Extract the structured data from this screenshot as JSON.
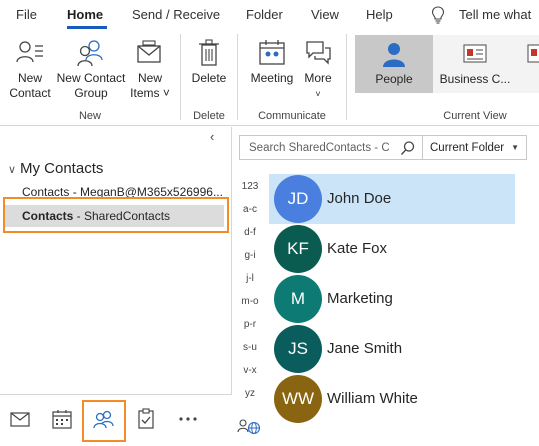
{
  "tabs": [
    {
      "label": "File",
      "active": false
    },
    {
      "label": "Home",
      "active": true
    },
    {
      "label": "Send / Receive",
      "active": false
    },
    {
      "label": "Folder",
      "active": false
    },
    {
      "label": "View",
      "active": false
    },
    {
      "label": "Help",
      "active": false
    }
  ],
  "tell_me": "Tell me what",
  "ribbon": {
    "new_contact": "New\nContact",
    "new_contact_group": "New Contact\nGroup",
    "new_items": "New\nItems",
    "group_new": "New",
    "delete": "Delete",
    "group_delete": "Delete",
    "meeting": "Meeting",
    "more": "More",
    "group_communicate": "Communicate",
    "people": "People",
    "business_card": "Business C...",
    "group_current_view": "Current View"
  },
  "folder_pane": {
    "section": "My Contacts",
    "items": [
      {
        "bold": "",
        "label": "Contacts - MeganB@M365x526996..."
      },
      {
        "bold": "Contacts",
        "label": " - SharedContacts"
      }
    ],
    "selected_index": 1
  },
  "bottom_nav": [
    "mail-icon",
    "calendar-icon",
    "people-icon",
    "tasks-icon",
    "more-icon"
  ],
  "search": {
    "placeholder": "Search SharedContacts - C",
    "scope": "Current Folder"
  },
  "alphabet": [
    "123",
    "a-c",
    "d-f",
    "g-i",
    "j-l",
    "m-o",
    "p-r",
    "s-u",
    "v-x",
    "yz"
  ],
  "contacts": [
    {
      "initials": "JD",
      "name": "John Doe",
      "color": "#4a7fe0",
      "selected": true
    },
    {
      "initials": "KF",
      "name": "Kate Fox",
      "color": "#0b5c50",
      "selected": false
    },
    {
      "initials": "M",
      "name": "Marketing",
      "color": "#0d7a73",
      "selected": false
    },
    {
      "initials": "JS",
      "name": "Jane Smith",
      "color": "#0b5c5c",
      "selected": false
    },
    {
      "initials": "WW",
      "name": "William White",
      "color": "#8a6511",
      "selected": false
    }
  ],
  "colors": {
    "accent": "#185abd",
    "highlight_outline": "#f28c28",
    "selected_row": "#cce4f7"
  }
}
